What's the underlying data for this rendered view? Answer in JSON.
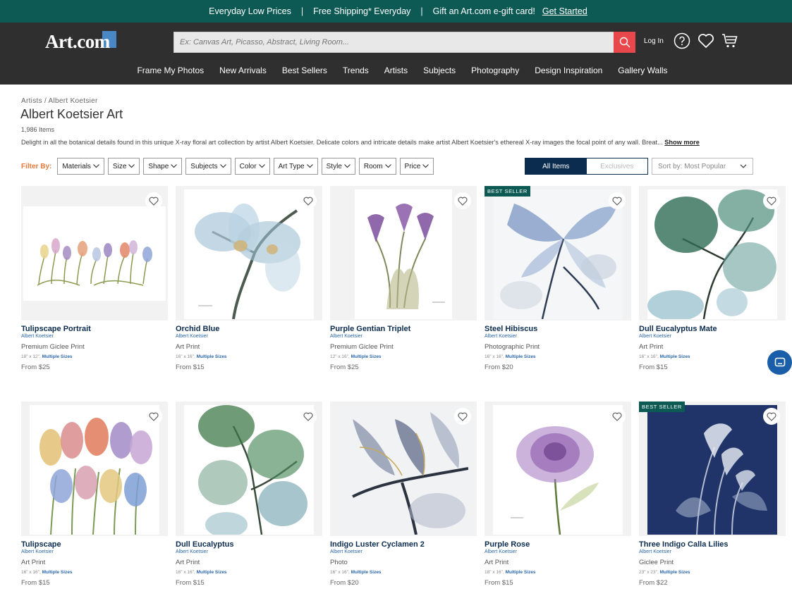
{
  "promo": {
    "item1": "Everyday Low Prices",
    "item2": "Free Shipping* Everyday",
    "item3": "Gift an Art.com e-gift card!",
    "link": "Get Started",
    "sep": "|"
  },
  "header": {
    "logo": "Art.com",
    "search_placeholder": "Ex: Canvas Art, Picasso, Abstract, Living Room...",
    "login": "Log In"
  },
  "nav": [
    "Frame My Photos",
    "New Arrivals",
    "Best Sellers",
    "Trends",
    "Artists",
    "Subjects",
    "Photography",
    "Design Inspiration",
    "Gallery Walls"
  ],
  "breadcrumb": "Artists / Albert Koetsier",
  "title": "Albert Koetsier Art",
  "count": "1,986 Items",
  "description": "Delight in all the botanical details found in this unique X-ray floral art collection by artist Albert Koetsier. Delicate colors and intricate details make artist Albert Koetsier's ethereal X-ray images the focal point of any wall. Breat...",
  "show_more": "Show more",
  "filter_label": "Filter By:",
  "filters": [
    "Materials",
    "Size",
    "Shape",
    "Subjects",
    "Color",
    "Art Type",
    "Style",
    "Room",
    "Price"
  ],
  "toggle": {
    "all": "All Items",
    "exclusives": "Exclusives"
  },
  "sort": "Sort by: Most Popular",
  "badge_text": "BEST SELLER",
  "products": [
    {
      "title": "Tulipscape Portrait",
      "artist": "Albert Koetsier",
      "type": "Premium Giclee Print",
      "size": "18\" x 12\"",
      "multi": "Multiple Sizes",
      "price": "From $25"
    },
    {
      "title": "Orchid Blue",
      "artist": "Albert Koetsier",
      "type": "Art Print",
      "size": "16\" x 16\"",
      "multi": "Multiple Sizes",
      "price": "From $15"
    },
    {
      "title": "Purple Gentian Triplet",
      "artist": "Albert Koetsier",
      "type": "Premium Giclee Print",
      "size": "12\" x 16\"",
      "multi": "Multiple Sizes",
      "price": "From $25"
    },
    {
      "title": "Steel Hibiscus",
      "artist": "Albert Koetsier",
      "type": "Photographic Print",
      "size": "16\" x 16\"",
      "multi": "Multiple Sizes",
      "price": "From $20"
    },
    {
      "title": "Dull Eucalyptus Mate",
      "artist": "Albert Koetsier",
      "type": "Art Print",
      "size": "16\" x 16\"",
      "multi": "Multiple Sizes",
      "price": "From $15"
    },
    {
      "title": "Tulipscape",
      "artist": "Albert Koetsier",
      "type": "Art Print",
      "size": "16\" x 16\"",
      "multi": "Multiple Sizes",
      "price": "From $15"
    },
    {
      "title": "Dull Eucalyptus",
      "artist": "Albert Koetsier",
      "type": "Art Print",
      "size": "16\" x 16\"",
      "multi": "Multiple Sizes",
      "price": "From $15"
    },
    {
      "title": "Indigo Luster Cyclamen 2",
      "artist": "Albert Koetsier",
      "type": "Photo",
      "size": "16\" x 16\"",
      "multi": "Multiple Sizes",
      "price": "From $20"
    },
    {
      "title": "Purple Rose",
      "artist": "Albert Koetsier",
      "type": "Art Print",
      "size": "18\" x 16\"",
      "multi": "Multiple Sizes",
      "price": "From $15"
    },
    {
      "title": "Three Indigo Calla Lilies",
      "artist": "Albert Koetsier",
      "type": "Giclee Print",
      "size": "23\" x 23\"",
      "multi": "Multiple Sizes",
      "price": "From $22"
    }
  ],
  "colors": {
    "promo_bg": "#0d5a55",
    "header_bg": "#2f2f2f",
    "search_btn": "#e8474c",
    "accent": "#e5793b",
    "navy": "#0c2c4f",
    "link": "#2b67a8"
  }
}
